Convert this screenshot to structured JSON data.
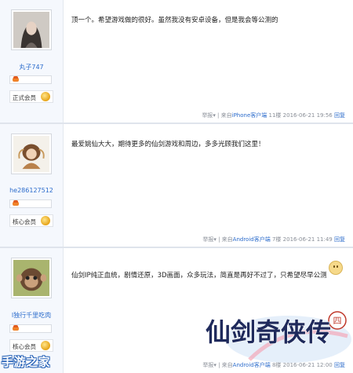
{
  "posts": [
    {
      "username": "丸子747",
      "member_label": "正式会员",
      "content": "顶一个。希望游戏做的很好。虽然我没有安卓设备，但是我会等公测的",
      "report": "举报",
      "source_prefix": "来自",
      "device": "iPhone客户端",
      "floor": "11楼",
      "time": "2016-06-21 19:56",
      "reply": "回复"
    },
    {
      "username": "he286127512",
      "member_label": "核心会员",
      "content": "最爱姚仙大大，期待更多的仙剑游戏和周边，多多光顾我们这里！",
      "report": "举报",
      "source_prefix": "来自",
      "device": "Android客户端",
      "floor": "7楼",
      "time": "2016-06-21 11:49",
      "reply": "回复"
    },
    {
      "username": "l独行千里吃肉",
      "member_label": "核心会员",
      "content": "仙剑IP纯正血统，剧情还原，3D画面，众多玩法，简直是再好不过了，只希望尽早公测",
      "report": "举报",
      "source_prefix": "来自",
      "device": "Android客户端",
      "floor": "8楼",
      "time": "2016-06-21 12:00",
      "reply": "回复"
    }
  ],
  "logo_text": "仙剑奇侠传",
  "logo_badge": "四",
  "watermark": "手游之家",
  "colors": {
    "link": "#2c6ccc",
    "sidebar": "#f5f8fd"
  }
}
